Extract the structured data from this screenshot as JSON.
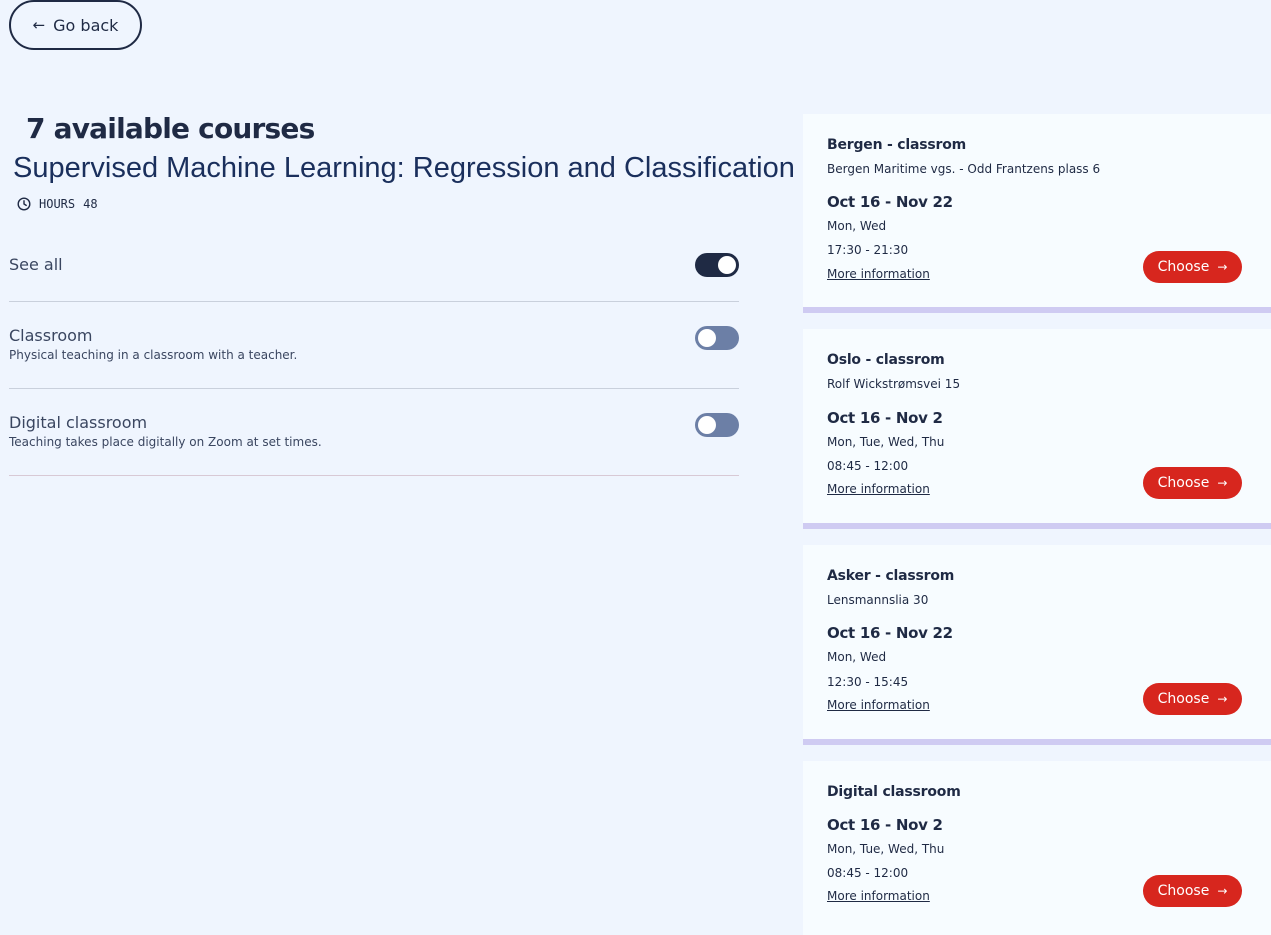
{
  "nav": {
    "back_label": "Go back",
    "back_icon": "arrow-left-icon"
  },
  "header": {
    "count_title": "7 available courses",
    "course_title": "Supervised Machine Learning: Regression and Classification",
    "hours_label": "HOURS",
    "hours_value": "48"
  },
  "filters": [
    {
      "label": "See all",
      "description": "",
      "on": true
    },
    {
      "label": "Classroom",
      "description": "Physical teaching in a classroom with a teacher.",
      "on": false
    },
    {
      "label": "Digital classroom",
      "description": "Teaching takes place digitally on Zoom at set times.",
      "on": false
    }
  ],
  "courses": [
    {
      "title": "Bergen - classrom",
      "address": "Bergen Maritime vgs. - Odd Frantzens plass 6",
      "dates": "Oct 16 - Nov 22",
      "days": "Mon, Wed",
      "time": "17:30 - 21:30",
      "more": "More information",
      "choose": "Choose"
    },
    {
      "title": "Oslo - classrom",
      "address": "Rolf Wickstrømsvei 15",
      "dates": "Oct 16 - Nov 2",
      "days": "Mon, Tue, Wed, Thu",
      "time": "08:45 - 12:00",
      "more": "More information",
      "choose": "Choose"
    },
    {
      "title": "Asker - classrom",
      "address": "Lensmannslia 30",
      "dates": "Oct 16 - Nov 22",
      "days": "Mon, Wed",
      "time": "12:30 - 15:45",
      "more": "More information",
      "choose": "Choose"
    },
    {
      "title": "Digital classroom",
      "address": "",
      "dates": "Oct 16 - Nov 2",
      "days": "Mon, Tue, Wed, Thu",
      "time": "08:45 - 12:00",
      "more": "More information",
      "choose": "Choose"
    }
  ],
  "colors": {
    "background": "#eff5fe",
    "primary": "#1f2a44",
    "accent": "#d7261e",
    "card_border": "#cfcbf2"
  }
}
